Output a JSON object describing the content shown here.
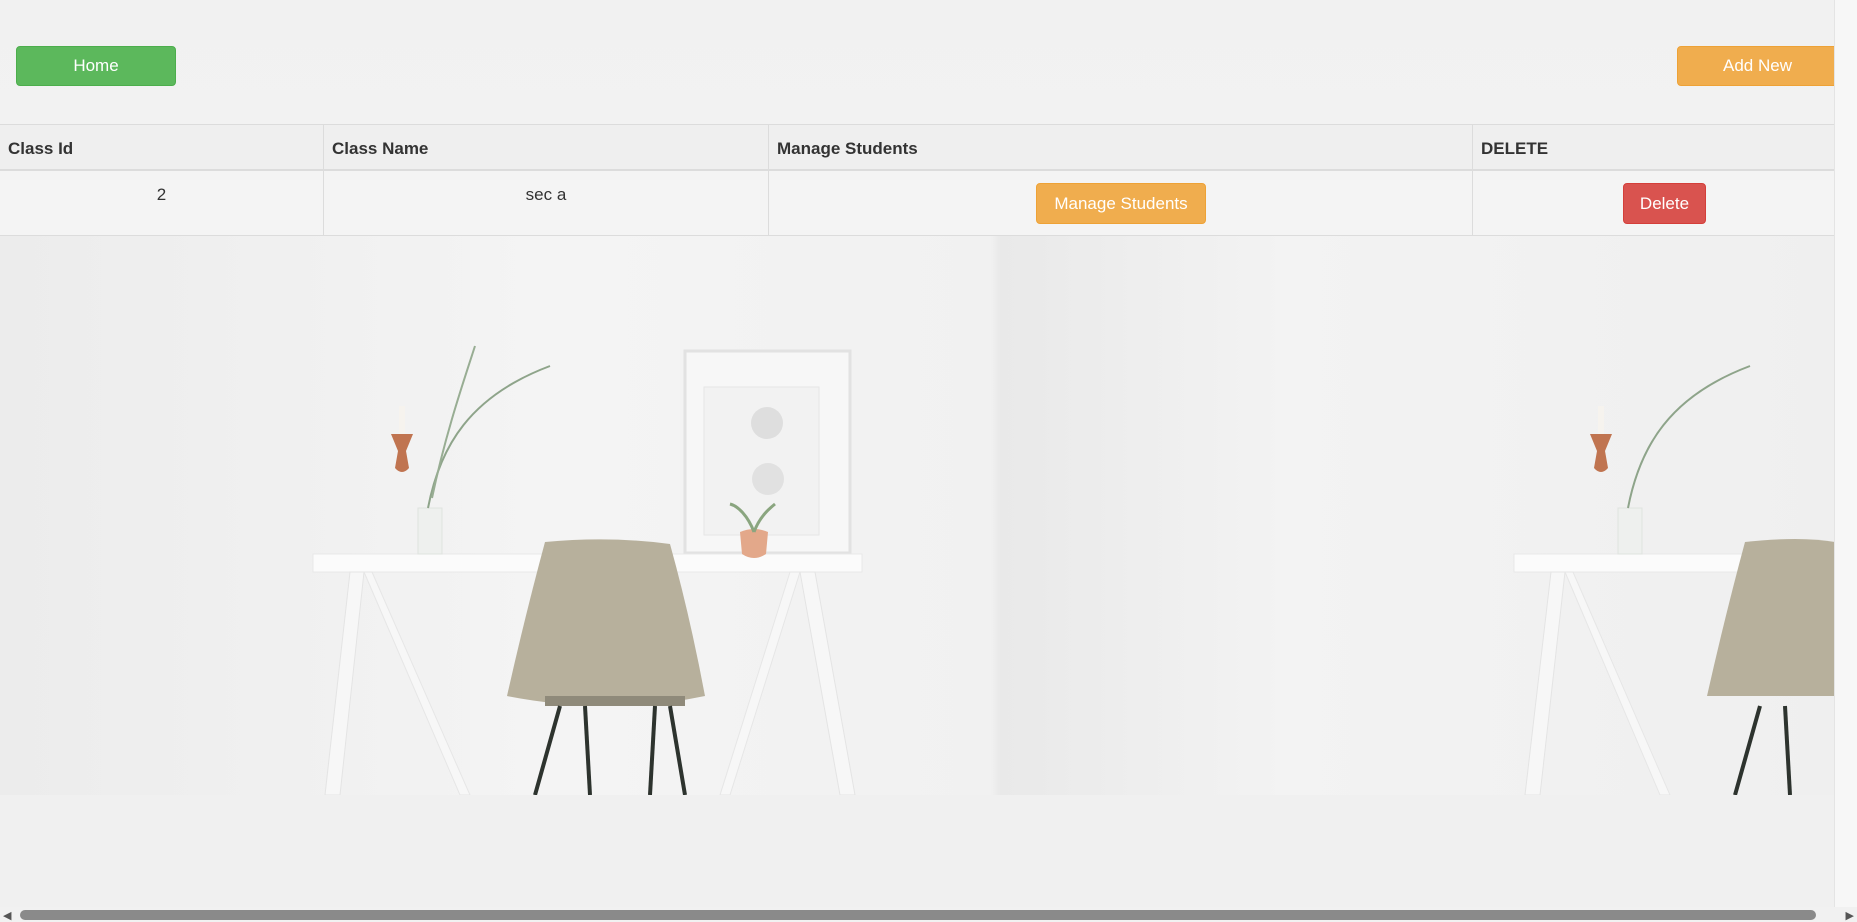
{
  "toolbar": {
    "home_label": "Home",
    "add_new_label": "Add New"
  },
  "table": {
    "headers": [
      "Class Id",
      "Class Name",
      "Manage Students",
      "DELETE"
    ],
    "rows": [
      {
        "class_id": "2",
        "class_name": "sec a",
        "manage_label": "Manage Students",
        "delete_label": "Delete"
      }
    ]
  },
  "colors": {
    "home_button": "#5cb85c",
    "warning_button": "#f0ad4e",
    "danger_button": "#d9534f"
  },
  "background": {
    "icon": "desk-chair-interior-photo"
  }
}
